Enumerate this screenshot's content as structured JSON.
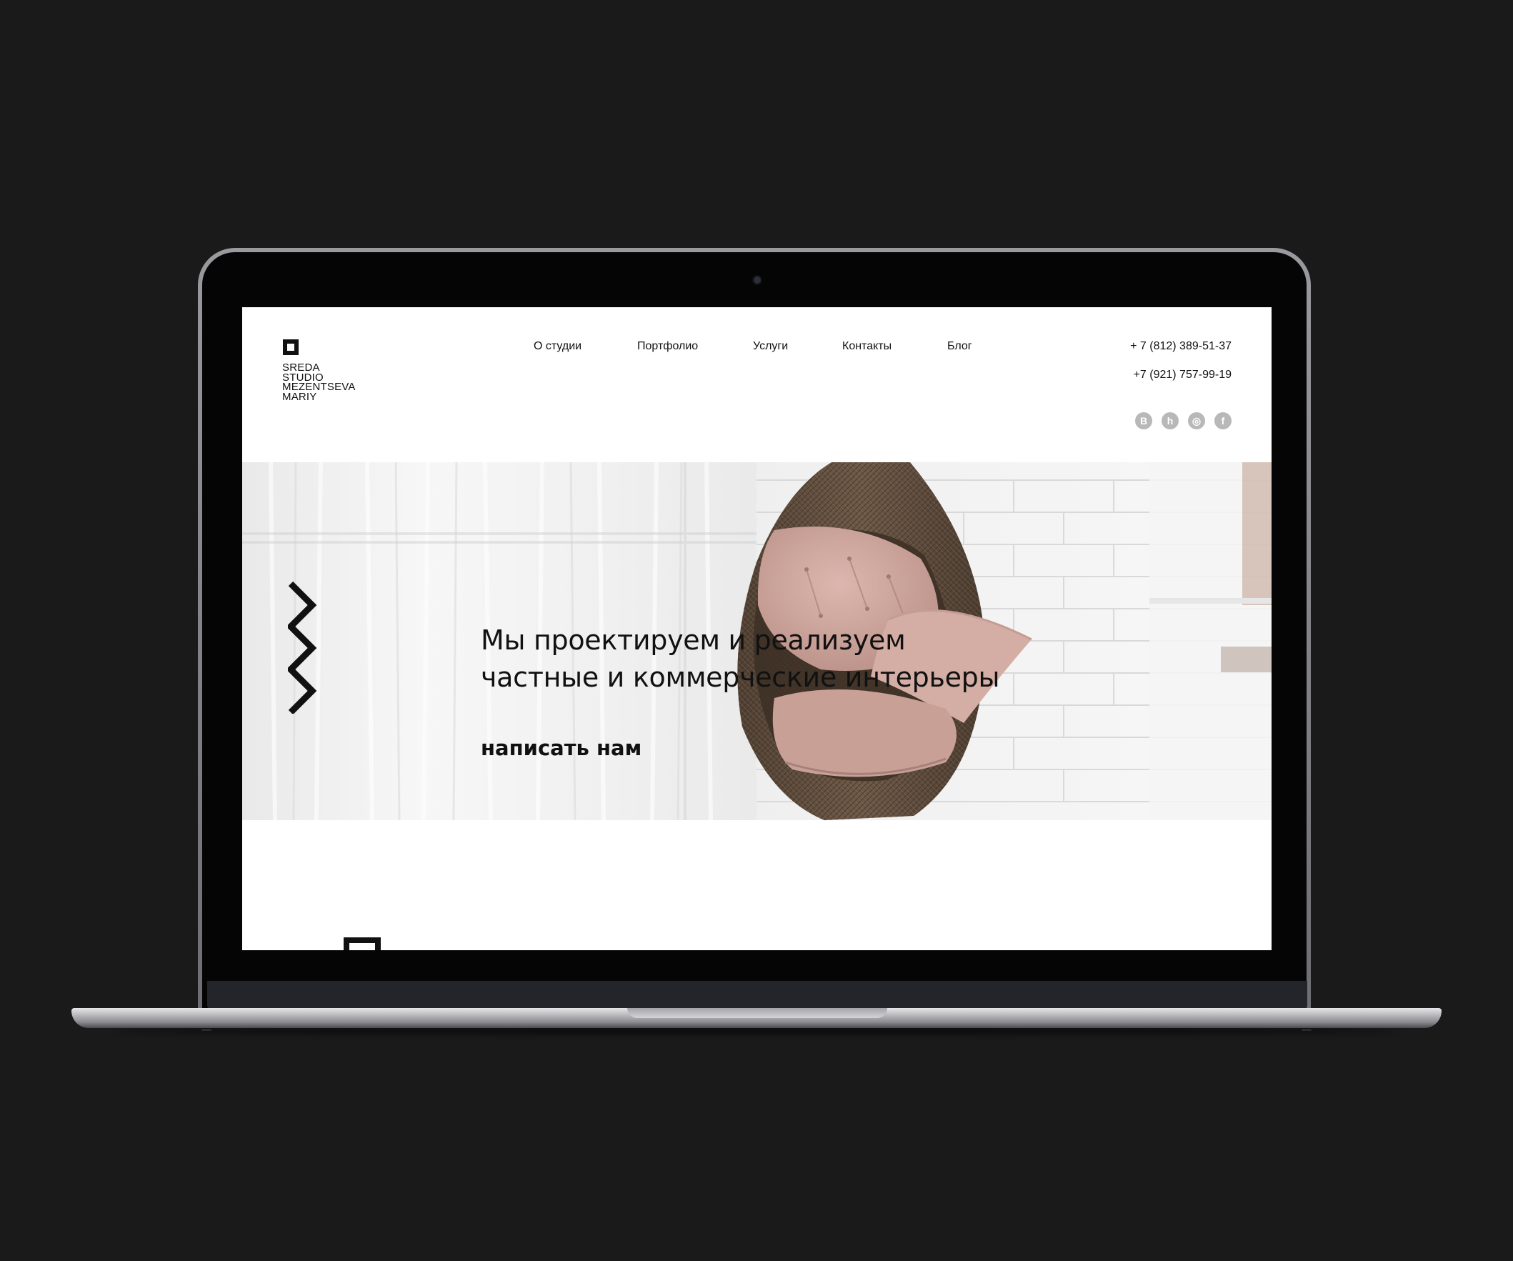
{
  "site": {
    "logo": {
      "icon": "square-logo-icon",
      "lines": [
        "SREDA",
        "STUDIO",
        "MEZENTSEVA",
        "MARIY"
      ]
    },
    "nav": [
      {
        "label": "О студии"
      },
      {
        "label": "Портфолио"
      },
      {
        "label": "Услуги"
      },
      {
        "label": "Контакты"
      },
      {
        "label": "Блог"
      }
    ],
    "contacts": {
      "phone1": "+ 7 (812) 389-51-37",
      "phone2": "+7 (921) 757-99-19"
    },
    "socials": [
      {
        "icon": "vk-icon",
        "glyph": "В"
      },
      {
        "icon": "houzz-icon",
        "glyph": "h"
      },
      {
        "icon": "instagram-icon",
        "glyph": "◎"
      },
      {
        "icon": "facebook-icon",
        "glyph": "f"
      }
    ],
    "hero": {
      "title_line1": "Мы проектируем и реализуем",
      "title_line2": "частные и коммерческие интерьеры",
      "cta": "написать нам",
      "image": "hanging-wicker-chair-photo"
    }
  },
  "colors": {
    "page_background": "#1a1a1a",
    "screen_background": "#ffffff",
    "text": "#111111",
    "social_icon_bg": "#b8b8b8",
    "cushion_pink": "#c9a29b",
    "wicker_brown": "#5e4a3a"
  }
}
